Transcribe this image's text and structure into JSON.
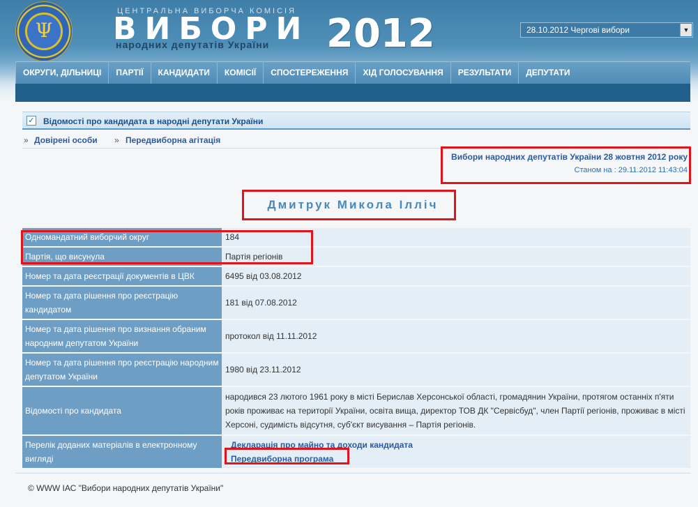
{
  "header": {
    "cvk_label": "ЦЕНТРАЛЬНА ВИБОРЧА КОМІСІЯ",
    "title": "ВИБОРИ",
    "subtitle": "народних депутатів України",
    "year": "2012",
    "emblem_icon": "trident-emblem-icon",
    "election_select": {
      "value": "28.10.2012 Чергові вибори"
    }
  },
  "nav": {
    "items": [
      {
        "label": "ОКРУГИ, ДІЛЬНИЦІ"
      },
      {
        "label": "ПАРТІЇ"
      },
      {
        "label": "КАНДИДАТИ"
      },
      {
        "label": "КОМІСІЇ"
      },
      {
        "label": "СПОСТЕРЕЖЕННЯ"
      },
      {
        "label": "ХІД ГОЛОСУВАННЯ"
      },
      {
        "label": "РЕЗУЛЬТАТИ"
      },
      {
        "label": "ДЕПУТАТИ"
      }
    ]
  },
  "section": {
    "title": "Відомості про кандидата в народні депутати України",
    "links": [
      {
        "label": "Довірені особи"
      },
      {
        "label": "Передвиборна агітація"
      }
    ]
  },
  "election_info": {
    "link": "Вибори народних депутатів України 28 жовтня 2012 року",
    "status_label": "Станом на :",
    "status_value": "29.11.2012 11:43:04"
  },
  "candidate": {
    "name": "Дмитрук Микола Ілліч",
    "rows": [
      {
        "label": "Одномандатний виборчий округ",
        "value": "184"
      },
      {
        "label": "Партія, що висунула",
        "value": "Партія регіонів"
      },
      {
        "label": "Номер та дата реєстрації документів в ЦВК",
        "value": "6495 від 03.08.2012"
      },
      {
        "label": "Номер та дата рішення про реєстрацію кандидатом",
        "value": "181 від 07.08.2012"
      },
      {
        "label": "Номер та дата рішення про визнання обраним народним депутатом України",
        "value": "протокол від 11.11.2012"
      },
      {
        "label": "Номер та дата рішення про реєстрацію народним депутатом України",
        "value": "1980 від 23.11.2012"
      },
      {
        "label": "Відомості про кандидата",
        "value": "народився 23 лютого 1961 року в місті Берислав Херсонської області, громадянин України, протягом останніх п'яти років проживає на території України, освіта вища, директор ТОВ ДК \"Сервісбуд\", член Партії регіонів, проживає в місті Херсоні, судимість відсутня, суб'єкт висування – Партія регіонів."
      }
    ],
    "materials": {
      "label": "Перелік доданих матеріалів в електронному вигляді",
      "links": [
        {
          "label": "Декларація про майно та доходи кандидата"
        },
        {
          "label": "Передвиборна програма"
        }
      ]
    }
  },
  "footer": {
    "text": "© WWW ІАС \"Вибори народних депутатів України\""
  },
  "colors": {
    "header_blue": "#4f8fb8",
    "nav_dark": "#215f8b",
    "label_cell": "#6f9ec4",
    "value_cell": "#e3eef6",
    "highlight": "#e0141b"
  }
}
